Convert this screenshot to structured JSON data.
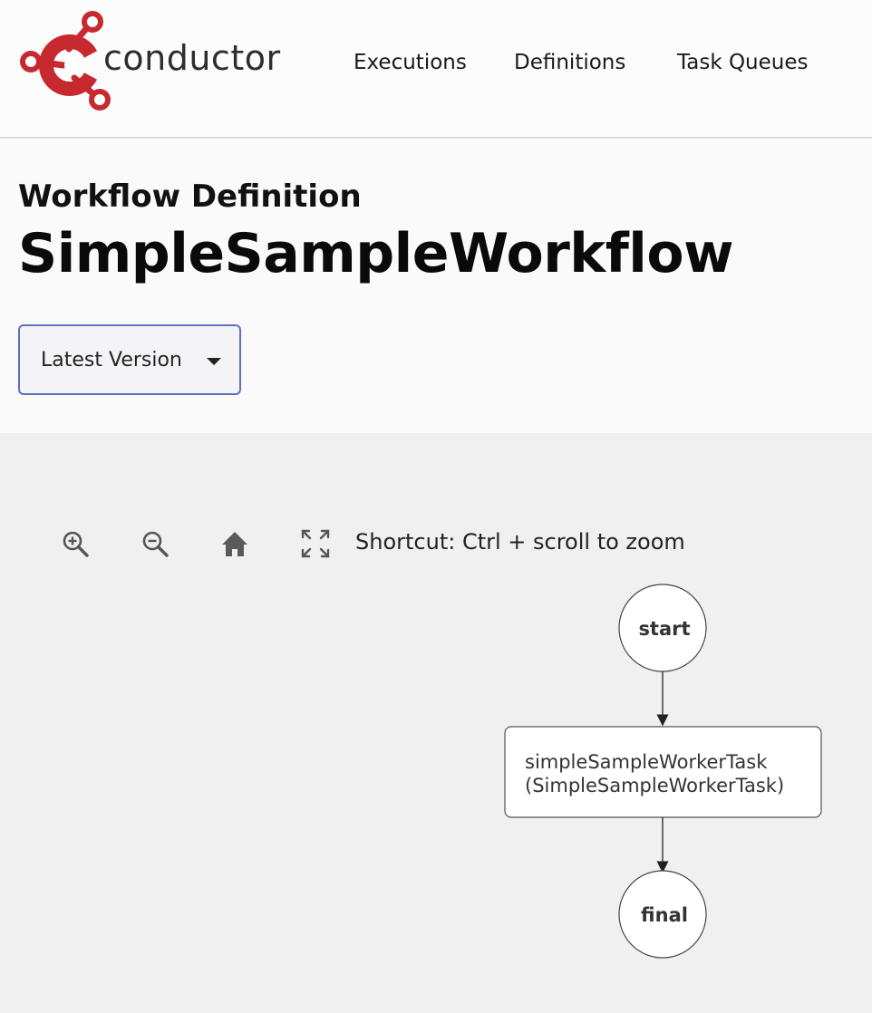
{
  "app": {
    "logo_text": "conductor"
  },
  "nav": {
    "executions": "Executions",
    "definitions": "Definitions",
    "task_queues": "Task Queues"
  },
  "page": {
    "subtitle": "Workflow Definition",
    "title": "SimpleSampleWorkflow"
  },
  "version_select": {
    "selected": "Latest Version"
  },
  "toolbar": {
    "zoom_in_icon": "zoom-in-icon",
    "zoom_out_icon": "zoom-out-icon",
    "home_icon": "home-icon",
    "fullscreen_icon": "fullscreen-icon",
    "shortcut_hint": "Shortcut: Ctrl + scroll to zoom"
  },
  "graph": {
    "start_label": "start",
    "task_name": "simpleSampleWorkerTask",
    "task_ref": "(SimpleSampleWorkerTask)",
    "final_label": "final"
  },
  "colors": {
    "brand_red": "#c62a2f",
    "accent_blue": "#5b72c4"
  }
}
